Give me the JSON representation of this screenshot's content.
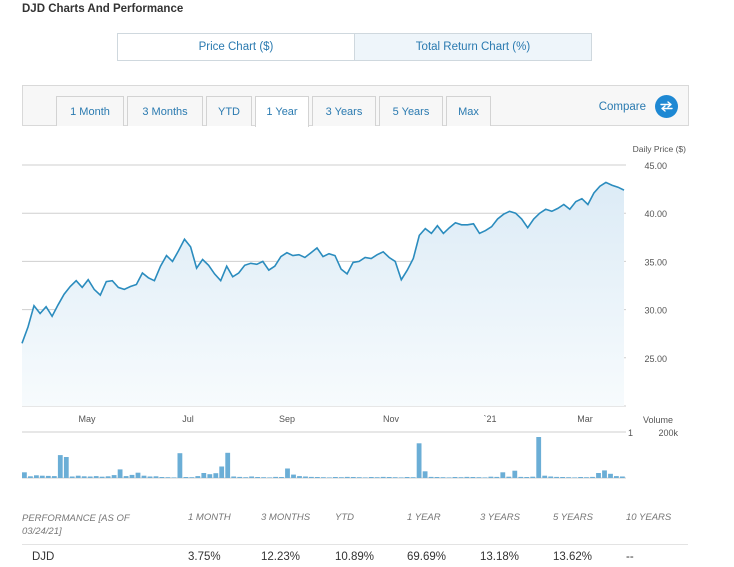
{
  "title": "DJD Charts And Performance",
  "chart_toggle": {
    "price_label": "Price Chart ($)",
    "total_label": "Total Return Chart (%)"
  },
  "ranges": [
    "1 Month",
    "3 Months",
    "YTD",
    "1 Year",
    "3 Years",
    "5 Years",
    "Max"
  ],
  "active_range": "1 Year",
  "compare_label": "Compare",
  "colors": {
    "accent": "#2a7ab0",
    "line": "#2b8cbe",
    "area": "#e6f1f8",
    "volume": "#6baed6",
    "compare_bg": "#1e88d3"
  },
  "chart_data": [
    {
      "type": "area",
      "ylabel": "Daily Price ($)",
      "ylim": [
        20,
        45
      ],
      "yticks": [
        "45.00",
        "40.00",
        "35.00",
        "30.00",
        "25.00"
      ],
      "xticks": [
        "May",
        "Jul",
        "Sep",
        "Nov",
        "`21",
        "Mar"
      ],
      "series": [
        {
          "values": [
            26.5,
            28.2,
            30.4,
            29.6,
            30.3,
            29.3,
            30.5,
            31.6,
            32.4,
            33.0,
            32.3,
            33.1,
            32.1,
            31.5,
            32.9,
            33.0,
            32.3,
            32.1,
            32.4,
            32.6,
            33.8,
            33.3,
            33.0,
            34.5,
            35.6,
            35.0,
            36.1,
            37.3,
            36.5,
            34.3,
            35.2,
            34.6,
            33.7,
            33.0,
            34.5,
            33.4,
            33.8,
            34.6,
            34.8,
            34.7,
            35.0,
            34.1,
            34.5,
            35.5,
            35.9,
            35.6,
            35.7,
            35.4,
            35.9,
            36.4,
            35.5,
            35.8,
            35.6,
            34.2,
            33.7,
            34.9,
            35.0,
            35.4,
            35.3,
            35.7,
            36.0,
            35.4,
            35.0,
            33.1,
            34.1,
            35.3,
            37.7,
            38.4,
            37.9,
            38.7,
            37.9,
            38.5,
            39.0,
            38.8,
            38.8,
            38.9,
            37.9,
            38.2,
            38.6,
            39.4,
            39.9,
            40.2,
            40.0,
            39.4,
            38.5,
            39.4,
            40.0,
            40.4,
            40.2,
            40.5,
            40.9,
            40.4,
            41.2,
            41.5,
            40.9,
            42.1,
            42.8,
            43.2,
            42.9,
            42.7,
            42.4
          ]
        }
      ]
    },
    {
      "type": "bar",
      "ylabel": "Volume",
      "yticks": [
        "200k"
      ],
      "ylim": [
        0,
        220000
      ],
      "series": [
        {
          "values": [
            30000,
            9000,
            14000,
            12000,
            11000,
            10000,
            120000,
            110000,
            8000,
            12000,
            9000,
            8000,
            10000,
            7000,
            9000,
            15000,
            45000,
            10000,
            16000,
            28000,
            12000,
            8000,
            9000,
            5000,
            4000,
            3000,
            130000,
            5000,
            4000,
            10000,
            26000,
            20000,
            25000,
            60000,
            132000,
            8000,
            6000,
            4000,
            8000,
            5000,
            4000,
            3000,
            6000,
            5000,
            50000,
            18000,
            10000,
            8000,
            6000,
            5000,
            4000,
            3000,
            5000,
            4000,
            6000,
            5000,
            4000,
            3000,
            5000,
            4000,
            6000,
            5000,
            4000,
            3000,
            5000,
            4000,
            182000,
            35000,
            6000,
            5000,
            4000,
            3000,
            5000,
            4000,
            6000,
            5000,
            4000,
            3000,
            7000,
            6000,
            30000,
            7000,
            38000,
            6000,
            5000,
            7000,
            215000,
            12000,
            8000,
            6000,
            5000,
            4000,
            3000,
            5000,
            4000,
            6000,
            26000,
            40000,
            22000,
            10000,
            8000
          ]
        }
      ]
    }
  ],
  "performance": {
    "label": "PERFORMANCE [as of 03/24/21]",
    "columns": [
      "1 MONTH",
      "3 MONTHS",
      "YTD",
      "1 YEAR",
      "3 YEARS",
      "5 YEARS",
      "10 YEARS"
    ],
    "row": {
      "ticker": "DJD",
      "values": [
        "3.75%",
        "12.23%",
        "10.89%",
        "69.69%",
        "13.18%",
        "13.62%",
        "--"
      ]
    }
  }
}
